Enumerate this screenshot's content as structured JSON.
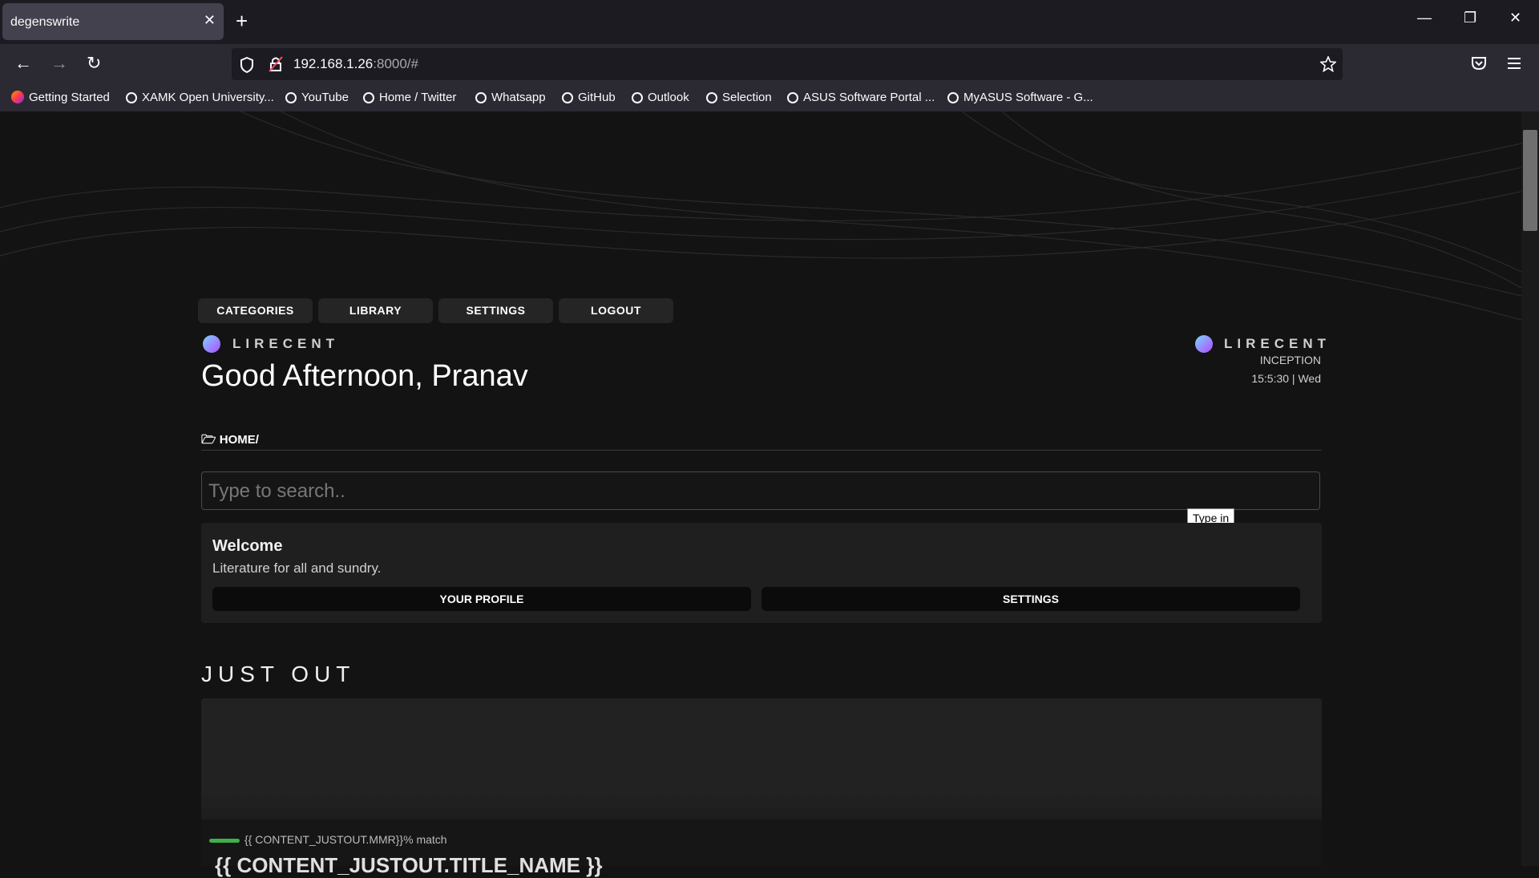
{
  "browser": {
    "tab_title": "degenswrite",
    "close_glyph": "✕",
    "newtab_glyph": "+",
    "win_min": "—",
    "win_restore": "❐",
    "win_close": "✕",
    "back_glyph": "←",
    "forward_glyph": "→",
    "reload_glyph": "↻",
    "url_host": "192.168.1.26",
    "url_path": ":8000/#",
    "bookmarks": [
      {
        "label": "Getting Started",
        "icon": "firefox-icon"
      },
      {
        "label": "XAMK Open University...",
        "icon": "globe-icon"
      },
      {
        "label": "YouTube",
        "icon": "globe-icon"
      },
      {
        "label": "Home / Twitter",
        "icon": "globe-icon"
      },
      {
        "label": "Whatsapp",
        "icon": "globe-icon"
      },
      {
        "label": "GitHub",
        "icon": "globe-icon"
      },
      {
        "label": "Outlook",
        "icon": "globe-icon"
      },
      {
        "label": "Selection",
        "icon": "globe-icon"
      },
      {
        "label": "ASUS Software Portal ...",
        "icon": "globe-icon"
      },
      {
        "label": "MyASUS Software - G...",
        "icon": "globe-icon"
      }
    ]
  },
  "nav": {
    "categories": "CATEGORIES",
    "library": "LIBRARY",
    "settings": "SETTINGS",
    "logout": "LOGOUT"
  },
  "header": {
    "brand": "LIRECENT",
    "greeting": "Good Afternoon, Pranav",
    "right_brand": "LIRECENT",
    "edition": "INCEPTION",
    "clock": "15:5:30 | Wed"
  },
  "breadcrumb": {
    "folder_glyph": "🗁",
    "path": "HOME/"
  },
  "search": {
    "placeholder": "Type to search..",
    "tooltip": "Type in"
  },
  "welcome": {
    "title": "Welcome",
    "subtitle": "Literature for all and sundry.",
    "profile_btn": "YOUR PROFILE",
    "settings_btn": "SETTINGS"
  },
  "just_out": {
    "heading": "JUST OUT",
    "mmr": "{{ CONTENT_JUSTOUT.MMR}}% match",
    "title": "{{ CONTENT_JUSTOUT.TITLE_NAME }}"
  },
  "colors": {
    "accent_green": "#3fb046",
    "background": "#131313"
  }
}
